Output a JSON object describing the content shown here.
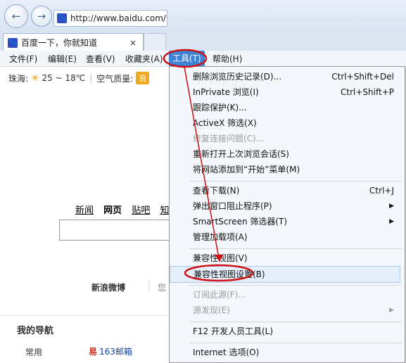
{
  "browser": {
    "url": "http://www.baidu.com/",
    "favicon_glyph": "🐾",
    "tab_title": "百度一下，你就知道",
    "tab_close": "×"
  },
  "menubar": {
    "items": [
      "文件(F)",
      "编辑(E)",
      "查看(V)",
      "收藏夹(A)",
      "工具(T)",
      "帮助(H)"
    ],
    "active_index": 4
  },
  "weather": {
    "city": "珠海:",
    "temp": "25 ~ 18℃",
    "air_label": "空气质量:",
    "air_value": "良"
  },
  "baidu": {
    "links": [
      "新闻",
      "网页",
      "贴吧",
      "知"
    ],
    "weibo": "新浪微博",
    "weibo_more": "您",
    "my_nav": "我的导航",
    "common": "常用",
    "mail_prefix": "易",
    "mail": "163邮箱"
  },
  "dropdown": {
    "items": [
      {
        "label": "删除浏览历史记录(D)...",
        "shortcut": "Ctrl+Shift+Del",
        "disabled": false
      },
      {
        "label": "InPrivate 浏览(I)",
        "shortcut": "Ctrl+Shift+P",
        "disabled": false
      },
      {
        "label": "跟踪保护(K)...",
        "shortcut": "",
        "disabled": false
      },
      {
        "label": "ActiveX 筛选(X)",
        "shortcut": "",
        "disabled": false
      },
      {
        "label": "修复连接问题(C)...",
        "shortcut": "",
        "disabled": true
      },
      {
        "label": "重新打开上次浏览会话(S)",
        "shortcut": "",
        "disabled": false
      },
      {
        "label": "将网站添加到“开始”菜单(M)",
        "shortcut": "",
        "disabled": false
      },
      {
        "label": "查看下载(N)",
        "shortcut": "Ctrl+J",
        "disabled": false
      },
      {
        "label": "弹出窗口阻止程序(P)",
        "shortcut": "",
        "disabled": false,
        "submenu": true
      },
      {
        "label": "SmartScreen 筛选器(T)",
        "shortcut": "",
        "disabled": false,
        "submenu": true
      },
      {
        "label": "管理加载项(A)",
        "shortcut": "",
        "disabled": false
      },
      {
        "label": "兼容性视图(V)",
        "shortcut": "",
        "disabled": false
      },
      {
        "label": "兼容性视图设置(B)",
        "shortcut": "",
        "disabled": false,
        "highlighted": true
      },
      {
        "label": "订阅此源(F)...",
        "shortcut": "",
        "disabled": true
      },
      {
        "label": "源发现(E)",
        "shortcut": "",
        "disabled": true,
        "submenu": true
      },
      {
        "label": "F12 开发人员工具(L)",
        "shortcut": "",
        "disabled": false
      },
      {
        "label": "Internet 选项(O)",
        "shortcut": "",
        "disabled": false
      }
    ]
  },
  "colors": {
    "menu_active": "#3e82d6",
    "annotation": "#d01010",
    "highlight_bg": "#e5eefb"
  }
}
